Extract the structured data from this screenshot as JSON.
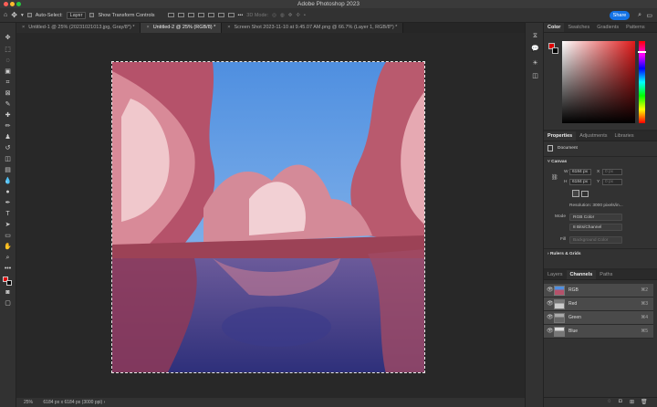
{
  "window": {
    "title": "Adobe Photoshop 2023"
  },
  "options": {
    "auto_select_label": "Auto-Select:",
    "auto_select_value": "Layer",
    "transform_controls_label": "Show Transform Controls",
    "mode_3d_label": "3D Mode:",
    "share_label": "Share"
  },
  "tabs": [
    {
      "label": "Untitled-1 @ 25% (20231021013.jpg, Gray/8*) *"
    },
    {
      "label": "Untitled-2 @ 25% (RGB/8) *"
    },
    {
      "label": "Screen Shot 2023-11-10 at 9.45.07 AM.png @ 66.7% (Layer 1, RGB/8*) *"
    }
  ],
  "status": {
    "zoom": "25%",
    "doc_size": "6184 px x 6184 px (3000 ppi)"
  },
  "color_panel": {
    "tabs": [
      "Color",
      "Swatches",
      "Gradients",
      "Patterns"
    ],
    "hue_color": "#e01a1a",
    "foreground": "#e00000"
  },
  "properties": {
    "tabs": [
      "Properties",
      "Adjustments",
      "Libraries"
    ],
    "document_label": "Document",
    "canvas_section": "Canvas",
    "w_label": "W",
    "w_value": "6184 px",
    "h_label": "H",
    "h_value": "6184 px",
    "x_label": "X",
    "x_value": "0 px",
    "y_label": "Y",
    "y_value": "0 px",
    "resolution": "Resolution: 3000 pixels/in...",
    "mode_label": "Mode",
    "mode_value": "RGB Color",
    "depth_value": "8 Bits/Channel",
    "fill_label": "Fill",
    "fill_value": "Background Color",
    "rulers_section": "Rulers & Grids"
  },
  "layers_panel": {
    "tabs": [
      "Layers",
      "Channels",
      "Paths"
    ],
    "channels": [
      {
        "name": "RGB",
        "shortcut": "⌘2"
      },
      {
        "name": "Red",
        "shortcut": "⌘3"
      },
      {
        "name": "Green",
        "shortcut": "⌘4"
      },
      {
        "name": "Blue",
        "shortcut": "⌘5"
      }
    ]
  }
}
